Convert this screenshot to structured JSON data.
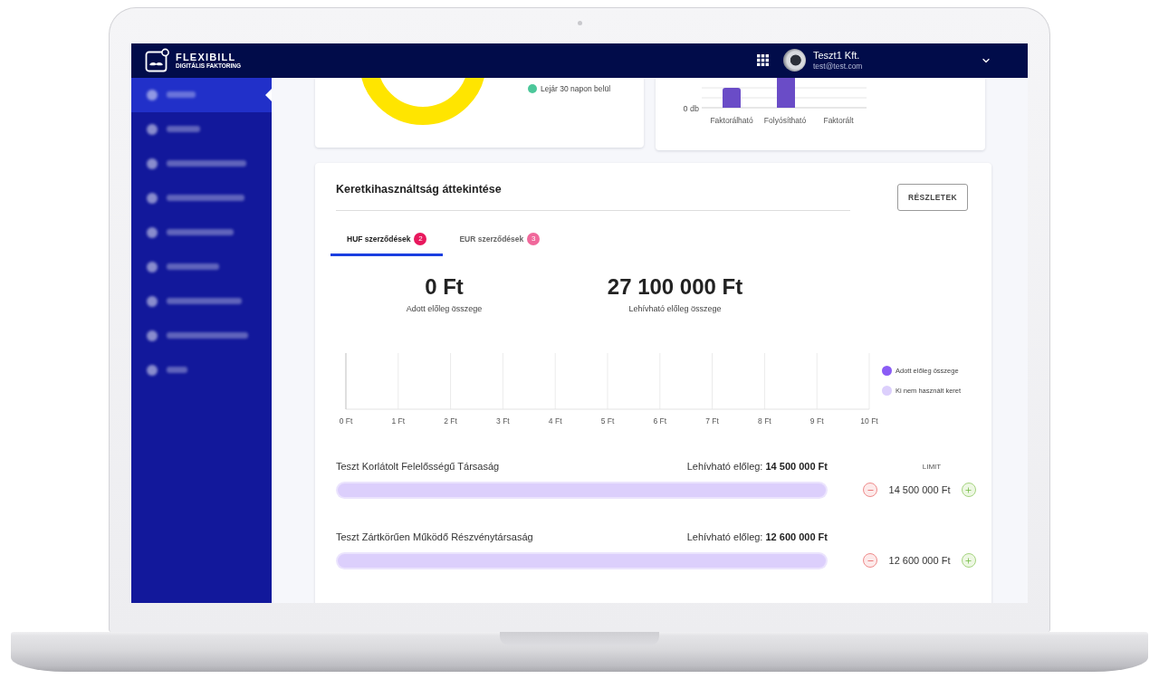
{
  "header": {
    "brand": "FLEXIBILL",
    "tagline": "DIGITÁLIS FAKTORING",
    "user": {
      "name": "Teszt1 Kft.",
      "email": "test@test.com"
    }
  },
  "sidebar": {
    "items": [
      {
        "selected": true
      },
      {
        "selected": false
      },
      {
        "selected": false
      },
      {
        "selected": false
      },
      {
        "selected": false
      },
      {
        "selected": false
      },
      {
        "selected": false
      },
      {
        "selected": false
      },
      {
        "selected": false
      }
    ]
  },
  "invoice_status_card": {
    "legend": [
      {
        "label": "Lejár 30 napon belül",
        "color": "#4cc79a"
      }
    ]
  },
  "invoice_count_card": {
    "y_tick": "0 db",
    "categories": [
      "Faktorálható",
      "Folyósítható",
      "Faktorált"
    ]
  },
  "limit_overview": {
    "title": "Keretkihasználtság áttekintése",
    "details_button": "RÉSZLETEK",
    "tabs": [
      {
        "label": "HUF szerződések",
        "count": "2",
        "selected": true
      },
      {
        "label": "EUR szerződések",
        "count": "3",
        "selected": false
      }
    ],
    "stats": [
      {
        "value": "0 Ft",
        "label": "Adott előleg összege"
      },
      {
        "value": "27 100 000 Ft",
        "label": "Lehívható előleg összege"
      }
    ],
    "chart_data": {
      "type": "bar",
      "orientation": "horizontal",
      "grid": true,
      "categories": [
        null
      ],
      "xlim": [
        0,
        10
      ],
      "xticks": [
        {
          "value": 0,
          "label": "0 Ft"
        },
        {
          "value": 1,
          "label": "1 Ft"
        },
        {
          "value": 2,
          "label": "2 Ft"
        },
        {
          "value": 3,
          "label": "3 Ft"
        },
        {
          "value": 4,
          "label": "4 Ft"
        },
        {
          "value": 5,
          "label": "5 Ft"
        },
        {
          "value": 6,
          "label": "6 Ft"
        },
        {
          "value": 7,
          "label": "7 Ft"
        },
        {
          "value": 8,
          "label": "8 Ft"
        },
        {
          "value": 9,
          "label": "9 Ft"
        },
        {
          "value": 10,
          "label": "10 Ft"
        }
      ],
      "series": [
        {
          "name": "Adott előleg összege",
          "color": "#8a5cf5",
          "values": [
            null
          ]
        },
        {
          "name": "Ki nem használt keret",
          "color": "#dccffc",
          "values": [
            null
          ]
        }
      ]
    },
    "limit_column_header": "LIMIT",
    "contracts": [
      {
        "name": "Teszt Korlátolt Felelősségű Társaság",
        "available": "Lehívható előleg: **14 500 000 Ft**",
        "level": 1,
        "limit": "14 500 000 Ft"
      },
      {
        "name": "Teszt Zártkörűen Működő Részvénytársaság",
        "available": "Lehívható előleg: **12 600 000 Ft**",
        "level": 1,
        "limit": "12 600 000 Ft"
      }
    ]
  }
}
